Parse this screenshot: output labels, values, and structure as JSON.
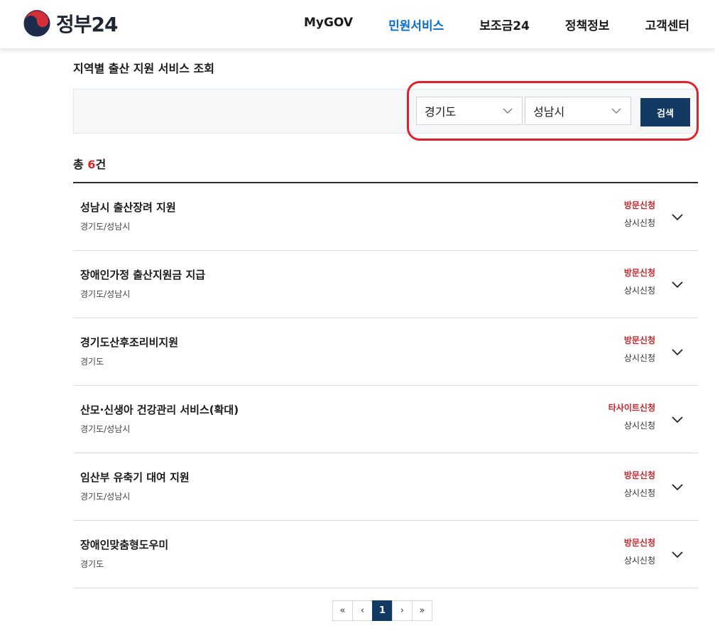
{
  "header": {
    "logo_text": "정부24",
    "nav": [
      {
        "label": "MyGOV",
        "active": false
      },
      {
        "label": "민원서비스",
        "active": true
      },
      {
        "label": "보조금24",
        "active": false
      },
      {
        "label": "정책정보",
        "active": false
      },
      {
        "label": "고객센터",
        "active": false
      }
    ]
  },
  "page_title": "지역별 출산 지원 서비스 조회",
  "search": {
    "province": "경기도",
    "city": "성남시",
    "button_label": "검색"
  },
  "total": {
    "prefix": "총 ",
    "count": "6",
    "suffix": "건"
  },
  "results": [
    {
      "title": "성남시 출산장려 지원",
      "region": "경기도/성남시",
      "method": "방문신청",
      "period": "상시신청"
    },
    {
      "title": "장애인가정 출산지원금 지급",
      "region": "경기도/성남시",
      "method": "방문신청",
      "period": "상시신청"
    },
    {
      "title": "경기도산후조리비지원",
      "region": "경기도",
      "method": "방문신청",
      "period": "상시신청"
    },
    {
      "title": "산모·신생아 건강관리 서비스(확대)",
      "region": "경기도/성남시",
      "method": "타사이트신청",
      "period": "상시신청"
    },
    {
      "title": "임산부 유축기 대여 지원",
      "region": "경기도/성남시",
      "method": "방문신청",
      "period": "상시신청"
    },
    {
      "title": "장애인맞춤형도우미",
      "region": "경기도",
      "method": "방문신청",
      "period": "상시신청"
    }
  ],
  "pagination": {
    "first": "«",
    "prev": "‹",
    "current": "1",
    "next": "›",
    "last": "»"
  },
  "colors": {
    "nav_active": "#0b6bcb",
    "button_bg": "#123a63",
    "method_red": "#c8262d",
    "highlight": "#e0202a"
  },
  "icons": [
    "taegeuk-logo-icon",
    "chevron-down-icon"
  ]
}
